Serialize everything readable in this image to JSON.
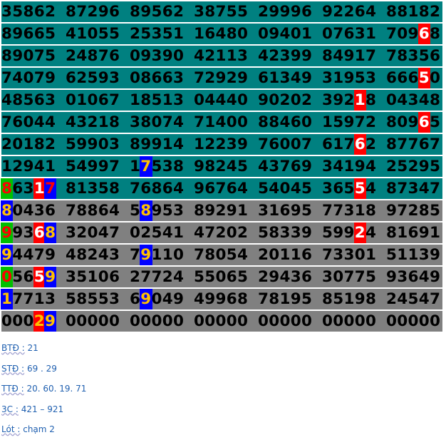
{
  "rows": [
    {
      "bg": "teal",
      "cells": [
        [
          {
            "t": "35862"
          }
        ],
        [
          {
            "t": "87296"
          }
        ],
        [
          {
            "t": "89562"
          }
        ],
        [
          {
            "t": "38755"
          }
        ],
        [
          {
            "t": "29996"
          }
        ],
        [
          {
            "t": "92264"
          }
        ],
        [
          {
            "t": "88182"
          }
        ]
      ]
    },
    {
      "bg": "teal",
      "cells": [
        [
          {
            "t": "89665"
          }
        ],
        [
          {
            "t": "41055"
          }
        ],
        [
          {
            "t": "25351"
          }
        ],
        [
          {
            "t": "16480"
          }
        ],
        [
          {
            "t": "09401"
          }
        ],
        [
          {
            "t": "07631"
          }
        ],
        [
          {
            "t": "709"
          },
          {
            "t": "6",
            "c": "red"
          },
          {
            "t": "8"
          }
        ]
      ]
    },
    {
      "bg": "teal",
      "cells": [
        [
          {
            "t": "89075"
          }
        ],
        [
          {
            "t": "24876"
          }
        ],
        [
          {
            "t": "09390"
          }
        ],
        [
          {
            "t": "42113"
          }
        ],
        [
          {
            "t": "42399"
          }
        ],
        [
          {
            "t": "84917"
          }
        ],
        [
          {
            "t": "78356"
          }
        ]
      ]
    },
    {
      "bg": "teal",
      "cells": [
        [
          {
            "t": "74079"
          }
        ],
        [
          {
            "t": "62593"
          }
        ],
        [
          {
            "t": "08663"
          }
        ],
        [
          {
            "t": "72929"
          }
        ],
        [
          {
            "t": "61349"
          }
        ],
        [
          {
            "t": "31953"
          }
        ],
        [
          {
            "t": "666"
          },
          {
            "t": "5",
            "c": "red"
          },
          {
            "t": "0"
          }
        ]
      ]
    },
    {
      "bg": "teal",
      "cells": [
        [
          {
            "t": "48563"
          }
        ],
        [
          {
            "t": "01067"
          }
        ],
        [
          {
            "t": "18513"
          }
        ],
        [
          {
            "t": "04440"
          }
        ],
        [
          {
            "t": "90202"
          }
        ],
        [
          {
            "t": "392"
          },
          {
            "t": "1",
            "c": "red"
          },
          {
            "t": "8"
          }
        ],
        [
          {
            "t": "04348"
          }
        ]
      ]
    },
    {
      "bg": "teal",
      "cells": [
        [
          {
            "t": "76044"
          }
        ],
        [
          {
            "t": "43218"
          }
        ],
        [
          {
            "t": "38074"
          }
        ],
        [
          {
            "t": "71400"
          }
        ],
        [
          {
            "t": "88460"
          }
        ],
        [
          {
            "t": "15972"
          }
        ],
        [
          {
            "t": "809"
          },
          {
            "t": "6",
            "c": "red"
          },
          {
            "t": "5"
          }
        ]
      ]
    },
    {
      "bg": "teal",
      "cells": [
        [
          {
            "t": "20182"
          }
        ],
        [
          {
            "t": "59903"
          }
        ],
        [
          {
            "t": "89914"
          }
        ],
        [
          {
            "t": "12239"
          }
        ],
        [
          {
            "t": "76007"
          }
        ],
        [
          {
            "t": "617"
          },
          {
            "t": "6",
            "c": "red"
          },
          {
            "t": "2"
          }
        ],
        [
          {
            "t": "87767"
          }
        ]
      ]
    },
    {
      "bg": "teal",
      "cells": [
        [
          {
            "t": "12941"
          }
        ],
        [
          {
            "t": "54997"
          }
        ],
        [
          {
            "t": "1"
          },
          {
            "t": "7",
            "c": "blue"
          },
          {
            "t": "538"
          }
        ],
        [
          {
            "t": "98245"
          }
        ],
        [
          {
            "t": "43769"
          }
        ],
        [
          {
            "t": "34194"
          }
        ],
        [
          {
            "t": "25295"
          }
        ]
      ]
    },
    {
      "bg": "teal",
      "cells": [
        [
          {
            "t": "8",
            "c": "green"
          },
          {
            "t": "63"
          },
          {
            "t": "1",
            "c": "red"
          },
          {
            "t": "7",
            "c": "bluered"
          }
        ],
        [
          {
            "t": "81358"
          }
        ],
        [
          {
            "t": "76864"
          }
        ],
        [
          {
            "t": "96764"
          }
        ],
        [
          {
            "t": "54045"
          }
        ],
        [
          {
            "t": "365"
          },
          {
            "t": "5",
            "c": "red"
          },
          {
            "t": "4"
          }
        ],
        [
          {
            "t": "87347"
          }
        ]
      ]
    },
    {
      "bg": "gray",
      "cells": [
        [
          {
            "t": "8",
            "c": "blue"
          },
          {
            "t": "0436"
          }
        ],
        [
          {
            "t": "78864"
          }
        ],
        [
          {
            "t": "5"
          },
          {
            "t": "8",
            "c": "blue"
          },
          {
            "t": "953"
          }
        ],
        [
          {
            "t": "89291"
          }
        ],
        [
          {
            "t": "31695"
          }
        ],
        [
          {
            "t": "77318"
          }
        ],
        [
          {
            "t": "97285"
          }
        ]
      ]
    },
    {
      "bg": "gray",
      "cells": [
        [
          {
            "t": "9",
            "c": "green"
          },
          {
            "t": "93"
          },
          {
            "t": "6",
            "c": "red"
          },
          {
            "t": "8",
            "c": "blue"
          }
        ],
        [
          {
            "t": "32047"
          }
        ],
        [
          {
            "t": "02541"
          }
        ],
        [
          {
            "t": "47202"
          }
        ],
        [
          {
            "t": "58339"
          }
        ],
        [
          {
            "t": "599"
          },
          {
            "t": "2",
            "c": "red"
          },
          {
            "t": "4"
          }
        ],
        [
          {
            "t": "81691"
          }
        ]
      ]
    },
    {
      "bg": "gray",
      "cells": [
        [
          {
            "t": "9",
            "c": "blue"
          },
          {
            "t": "4479"
          }
        ],
        [
          {
            "t": "48243"
          }
        ],
        [
          {
            "t": "7"
          },
          {
            "t": "9",
            "c": "blue"
          },
          {
            "t": "110"
          }
        ],
        [
          {
            "t": "78054"
          }
        ],
        [
          {
            "t": "20116"
          }
        ],
        [
          {
            "t": "73301"
          }
        ],
        [
          {
            "t": "51139"
          }
        ]
      ]
    },
    {
      "bg": "gray",
      "cells": [
        [
          {
            "t": "0",
            "c": "green"
          },
          {
            "t": "56"
          },
          {
            "t": "5",
            "c": "red"
          },
          {
            "t": "9",
            "c": "blue"
          }
        ],
        [
          {
            "t": "35106"
          }
        ],
        [
          {
            "t": "27724"
          }
        ],
        [
          {
            "t": "55065"
          }
        ],
        [
          {
            "t": "29436"
          }
        ],
        [
          {
            "t": "30775"
          }
        ],
        [
          {
            "t": "93649"
          }
        ]
      ]
    },
    {
      "bg": "gray",
      "cells": [
        [
          {
            "t": "1",
            "c": "blue"
          },
          {
            "t": "7713"
          }
        ],
        [
          {
            "t": "58553"
          }
        ],
        [
          {
            "t": "6"
          },
          {
            "t": "9",
            "c": "blue"
          },
          {
            "t": "049"
          }
        ],
        [
          {
            "t": "49968"
          }
        ],
        [
          {
            "t": "78195"
          }
        ],
        [
          {
            "t": "85198"
          }
        ],
        [
          {
            "t": "24547"
          }
        ]
      ]
    },
    {
      "bg": "gray",
      "cells": [
        [
          {
            "t": "000"
          },
          {
            "t": "2",
            "c": "redorange"
          },
          {
            "t": "9",
            "c": "blue"
          }
        ],
        [
          {
            "t": "00000"
          }
        ],
        [
          {
            "t": "00000"
          }
        ],
        [
          {
            "t": "00000"
          }
        ],
        [
          {
            "t": "00000"
          }
        ],
        [
          {
            "t": "00000"
          }
        ],
        [
          {
            "t": "00000"
          }
        ]
      ]
    }
  ],
  "notes": [
    {
      "label": "BTĐ :",
      "value": "21"
    },
    {
      "label": "STĐ :",
      "value": "69 . 29"
    },
    {
      "label": "TTĐ :",
      "value": "20. 60. 19. 71"
    },
    {
      "label": "3C :",
      "value": "421 – 921"
    },
    {
      "label": "Lót :",
      "value": "chạm 2"
    }
  ],
  "colors": {
    "teal": "#008080",
    "gray": "#808080",
    "red": "#ff0000",
    "blue": "#0000ff",
    "green": "#00c000",
    "gold": "#ffc000"
  }
}
